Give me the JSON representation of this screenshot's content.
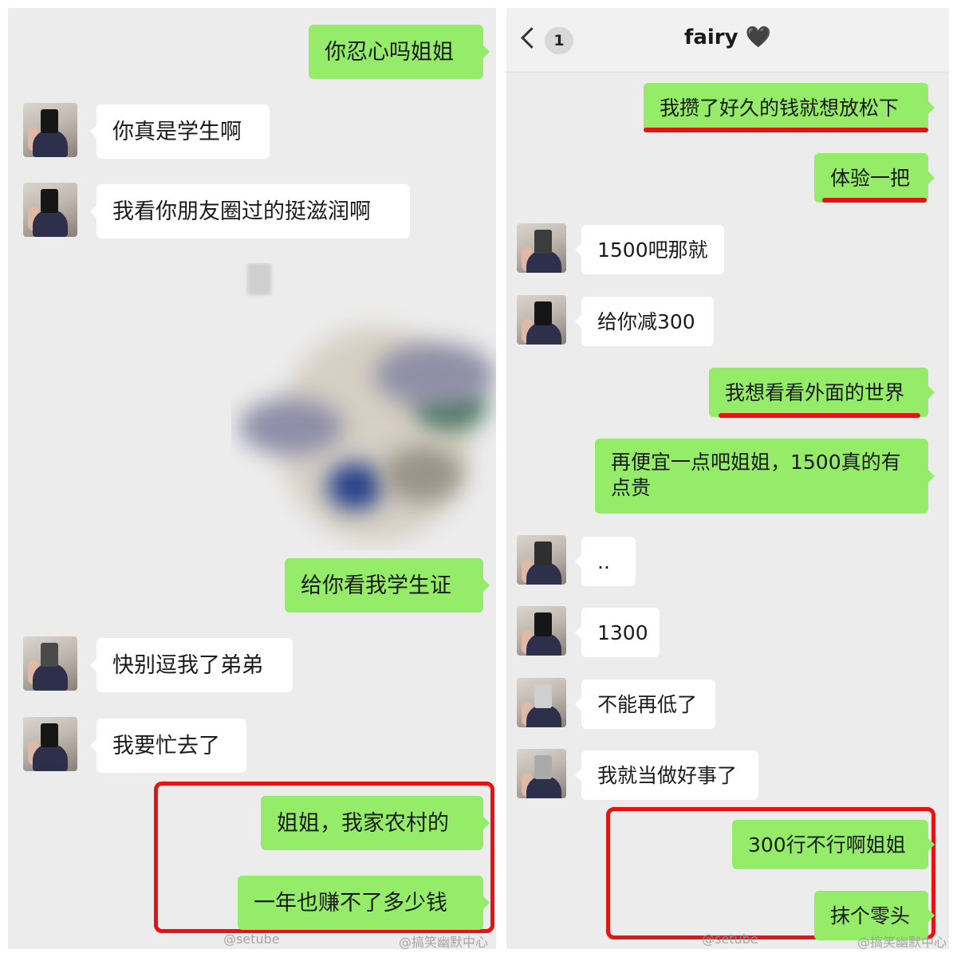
{
  "left_chat": {
    "messages": [
      {
        "side": "out",
        "text": "你忍心吗姐姐"
      },
      {
        "side": "in",
        "text": "你真是学生啊"
      },
      {
        "side": "in",
        "text": "我看你朋友圈过的挺滋润啊"
      },
      {
        "side": "out",
        "text": "给你看我学生证"
      },
      {
        "side": "in",
        "text": "快别逗我了弟弟"
      },
      {
        "side": "in",
        "text": "我要忙去了"
      },
      {
        "side": "out",
        "text": "姐姐，我家农村的"
      },
      {
        "side": "out",
        "text": "一年也赚不了多少钱"
      }
    ],
    "watermarks": [
      "@setube",
      "@搞笑幽默中心"
    ]
  },
  "right_chat": {
    "header": {
      "back_icon": "chevron-left-icon",
      "unread_count": "1",
      "title": "fairy 🖤"
    },
    "messages": [
      {
        "side": "out",
        "text": "我攒了好久的钱就想放松下"
      },
      {
        "side": "out",
        "text": "体验一把"
      },
      {
        "side": "in",
        "text": "1500吧那就"
      },
      {
        "side": "in",
        "text": "给你减300"
      },
      {
        "side": "out",
        "text": "我想看看外面的世界"
      },
      {
        "side": "out",
        "text": "再便宜一点吧姐姐，1500真的有点贵"
      },
      {
        "side": "in",
        "text": ".."
      },
      {
        "side": "in",
        "text": "1300"
      },
      {
        "side": "in",
        "text": "不能再低了"
      },
      {
        "side": "in",
        "text": "我就当做好事了"
      },
      {
        "side": "out",
        "text": "300行不行啊姐姐"
      },
      {
        "side": "out",
        "text": "抹个零头"
      }
    ],
    "watermarks": [
      "@setube",
      "@搞笑幽默中心"
    ]
  },
  "colors": {
    "outgoing_bubble": "#95ec69",
    "incoming_bubble": "#ffffff",
    "highlight": "#e31414",
    "background": "#ececec"
  }
}
